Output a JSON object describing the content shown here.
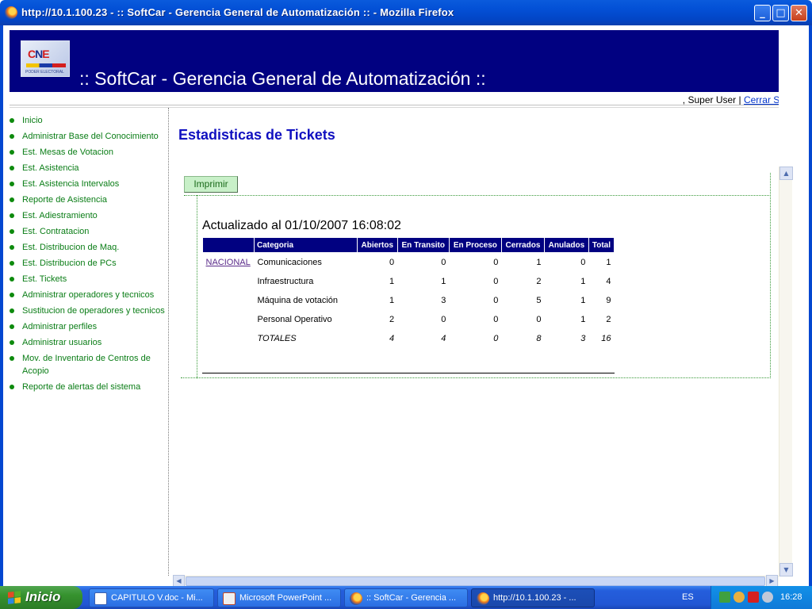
{
  "window": {
    "title": "http://10.1.100.23 - :: SoftCar - Gerencia General de Automatización :: - Mozilla Firefox",
    "min_glyph": "_",
    "max_glyph": "□",
    "close_glyph": "✕"
  },
  "header": {
    "logo_text_a": "C",
    "logo_text_b": "N",
    "logo_text_c": "E",
    "logo_caption": "PODER ELECTORAL",
    "site_title": ":: SoftCar - Gerencia General de Automatización ::",
    "user_prefix": ", Super User",
    "separator": "|",
    "logout_label": "Cerrar Sesion"
  },
  "sidebar": {
    "items": [
      {
        "label": "Inicio"
      },
      {
        "label": "Administrar Base del Conocimiento"
      },
      {
        "label": "Est. Mesas de Votacion"
      },
      {
        "label": "Est. Asistencia"
      },
      {
        "label": "Est. Asistencia Intervalos"
      },
      {
        "label": "Reporte de Asistencia"
      },
      {
        "label": "Est. Adiestramiento"
      },
      {
        "label": "Est. Contratacion"
      },
      {
        "label": "Est. Distribucion de Maq."
      },
      {
        "label": "Est. Distribucion de PCs"
      },
      {
        "label": "Est. Tickets"
      },
      {
        "label": "Administrar operadores y tecnicos"
      },
      {
        "label": "Sustitucion de operadores y tecnicos"
      },
      {
        "label": "Administrar perfiles"
      },
      {
        "label": "Administrar usuarios"
      },
      {
        "label": "Mov. de Inventario de Centros de Acopio"
      },
      {
        "label": "Reporte de alertas del sistema"
      }
    ]
  },
  "main": {
    "title": "Estadisticas de Tickets",
    "print_label": "Imprimir",
    "updated": "Actualizado al 01/10/2007 16:08:02"
  },
  "table": {
    "headers": [
      "",
      "Categoria",
      "Abiertos",
      "En Transito",
      "En Proceso",
      "Cerrados",
      "Anulados",
      "Total"
    ],
    "region": "NACIONAL",
    "rows": [
      [
        "Comunicaciones",
        "0",
        "0",
        "0",
        "1",
        "0",
        "1"
      ],
      [
        "Infraestructura",
        "1",
        "1",
        "0",
        "2",
        "1",
        "4"
      ],
      [
        "Máquina de votación",
        "1",
        "3",
        "0",
        "5",
        "1",
        "9"
      ],
      [
        "Personal Operativo",
        "2",
        "0",
        "0",
        "0",
        "1",
        "2"
      ]
    ],
    "totals": [
      "TOTALES",
      "4",
      "4",
      "0",
      "8",
      "3",
      "16"
    ]
  },
  "scroll": {
    "up": "▲",
    "down": "▼",
    "left": "◀",
    "right": "▶"
  },
  "taskbar": {
    "start_label": "Inicio",
    "tasks": [
      {
        "label": "CAPITULO V.doc - Mi..."
      },
      {
        "label": "Microsoft PowerPoint ..."
      },
      {
        "label": ":: SoftCar - Gerencia ..."
      },
      {
        "label": "http://10.1.100.23 - ..."
      }
    ],
    "language": "ES",
    "clock": "16:28"
  },
  "colors": {
    "banner": "#010181",
    "sidebar_link": "#0a7d16",
    "page_title": "#1010c0",
    "taskbar": "#245edc"
  }
}
